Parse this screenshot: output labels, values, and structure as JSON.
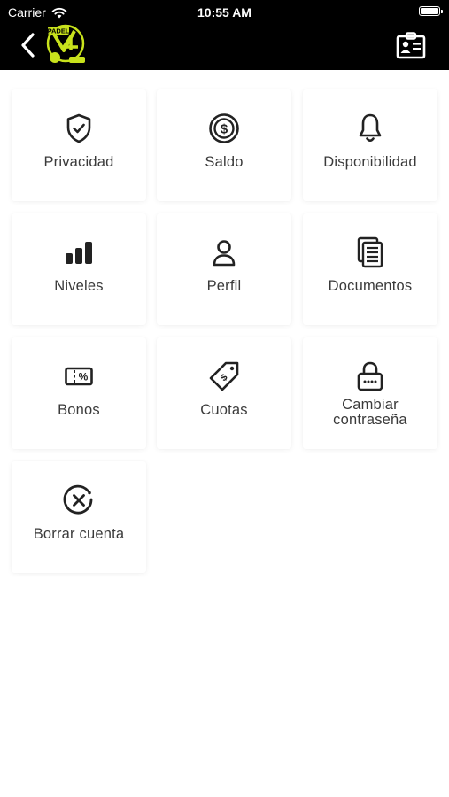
{
  "status_bar": {
    "carrier": "Carrier",
    "time": "10:55 AM"
  },
  "nav": {
    "back_icon": "chevron-left-icon",
    "logo_text": "PADEL",
    "logo_badge": "4",
    "right_icon": "id-card-icon"
  },
  "menu": {
    "items": [
      {
        "label": "Privacidad",
        "icon": "shield-check-icon"
      },
      {
        "label": "Saldo",
        "icon": "coin-dollar-icon"
      },
      {
        "label": "Disponibilidad",
        "icon": "bell-icon"
      },
      {
        "label": "Niveles",
        "icon": "level-bars-icon"
      },
      {
        "label": "Perfil",
        "icon": "user-icon"
      },
      {
        "label": "Documentos",
        "icon": "documents-icon"
      },
      {
        "label": "Bonos",
        "icon": "voucher-percent-icon"
      },
      {
        "label": "Cuotas",
        "icon": "price-tag-icon"
      },
      {
        "label": "Cambiar contraseña",
        "label_line1": "Cambiar",
        "label_line2": "contraseña",
        "icon": "lock-icon"
      },
      {
        "label": "Borrar cuenta",
        "icon": "circle-x-icon"
      }
    ]
  },
  "colors": {
    "bar_background": "#000000",
    "logo_accent": "#c8e21c",
    "text": "#3a3a3a",
    "icon": "#222222"
  }
}
